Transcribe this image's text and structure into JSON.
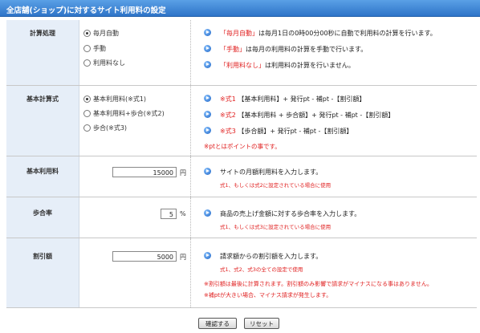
{
  "header": {
    "title": "全店舗(ショップ)に対するサイト利用料の設定"
  },
  "calc": {
    "label": "計算処理",
    "options": [
      "毎月自動",
      "手動",
      "利用料なし"
    ],
    "desc": [
      {
        "key": "「毎月自動」",
        "text": "は毎月1日の0時00分00秒に自動で利用料の計算を行います。"
      },
      {
        "key": "「手動」",
        "text": "は毎月の利用料の計算を手動で行います。"
      },
      {
        "key": "「利用料なし」",
        "text": "は利用料の計算を行いません。"
      }
    ]
  },
  "formula": {
    "label": "基本計算式",
    "options": [
      "基本利用料(※式1)",
      "基本利用料+歩合(※式2)",
      "歩合(※式3)"
    ],
    "lines": [
      {
        "tag": "※式1",
        "text": "【基本利用料】+ 発行pt - 補pt -【割引額】"
      },
      {
        "tag": "※式2",
        "text": "【基本利用料 + 歩合額】+ 発行pt - 補pt -【割引額】"
      },
      {
        "tag": "※式3",
        "text": "【歩合額】+ 発行pt - 補pt -【割引額】"
      }
    ],
    "note": "※ptとはポイントの事です。"
  },
  "base_fee": {
    "label": "基本利用料",
    "value": "15000",
    "unit": "円",
    "desc": "サイトの月額利用料を入力します。",
    "sub": "式1、もしくは式2に設定されている場合に使用"
  },
  "rate": {
    "label": "歩合率",
    "value": "5",
    "unit": "%",
    "desc": "商品の売上げ金額に対する歩合率を入力します。",
    "sub": "式1、もしくは式3に設定されている場合に使用"
  },
  "discount": {
    "label": "割引額",
    "value": "5000",
    "unit": "円",
    "desc": "請求額からの割引額を入力します。",
    "sub": "式1、式2、式3の全ての設定で使用",
    "notes": [
      "※割引額は最後に計算されます。割引額のみ影響で請求がマイナスになる事はありません。",
      "※補ptが大きい場合、マイナス請求が発生します。"
    ]
  },
  "buttons": {
    "confirm": "確認する",
    "reset": "リセット"
  }
}
